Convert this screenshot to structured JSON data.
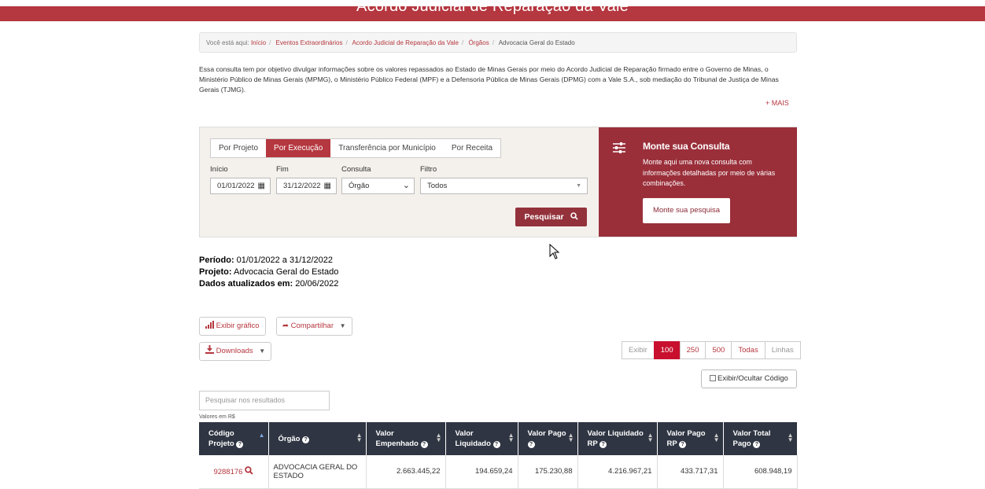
{
  "header": {
    "title": "Acordo Judicial de Reparação da Vale"
  },
  "breadcrumb": {
    "prefix": "Você está aqui:",
    "items": [
      "Início",
      "Eventos Extraordinários",
      "Acordo Judicial de Reparação da Vale",
      "Órgãos"
    ],
    "current": "Advocacia Geral do Estado"
  },
  "intro": {
    "text": "Essa consulta tem por objetivo divulgar informações sobre os valores repassados ao Estado de Minas Gerais por meio do Acordo Judicial de Reparação firmado entre o Governo de Minas, o Ministério Público de Minas Gerais (MPMG), o Ministério Público Federal (MPF) e a Defensoria Pública de Minas Gerais (DPMG) com a Vale S.A., sob mediação do Tribunal de Justiça de Minas Gerais (TJMG).",
    "more": "+ MAIS"
  },
  "filters": {
    "tabs": [
      "Por Projeto",
      "Por Execução",
      "Transferência por Município",
      "Por Receita"
    ],
    "active_tab": "Por Execução",
    "inicio_label": "Início",
    "inicio_value": "01/01/2022",
    "fim_label": "Fim",
    "fim_value": "31/12/2022",
    "consulta_label": "Consulta",
    "consulta_value": "Órgão",
    "filtro_label": "Filtro",
    "filtro_value": "Todos",
    "search_button": "Pesquisar"
  },
  "monte": {
    "title": "Monte sua Consulta",
    "desc": "Monte aqui uma nova consulta com informações detalhadas por meio de várias combinações.",
    "button": "Monte sua pesquisa"
  },
  "info": {
    "periodo_label": "Período:",
    "periodo_value": " 01/01/2022 a 31/12/2022",
    "projeto_label": "Projeto:",
    "projeto_value": " Advocacia Geral do Estado",
    "dados_label": "Dados atualizados em:",
    "dados_value": " 20/06/2022"
  },
  "actions": {
    "grafico": "Exibir gráfico",
    "compartilhar": "Compartilhar",
    "downloads": "Downloads",
    "toggle_code": "Exibir/Ocultar Código"
  },
  "pager": {
    "label": "Exibir",
    "options": [
      "100",
      "250",
      "500",
      "Todas"
    ],
    "selected": "100",
    "suffix": "Linhas"
  },
  "search": {
    "placeholder": "Pesquisar nos resultados"
  },
  "values_label": "Valores em R$",
  "table": {
    "columns": [
      "Código Projeto",
      "Órgão",
      "Valor Empenhado",
      "Valor Liquidado",
      "Valor Pago",
      "Valor Liquidado RP",
      "Valor Pago RP",
      "Valor Total Pago"
    ],
    "rows": [
      [
        "9288176",
        "ADVOCACIA GERAL DO ESTADO",
        "2.663.445,22",
        "194.659,24",
        "175.230,88",
        "4.216.967,21",
        "433.717,31",
        "608.948,19"
      ]
    ]
  },
  "colors": {
    "brand": "#b5373f",
    "panel_dark": "#9a2f3a",
    "table_header": "#2f3542"
  }
}
